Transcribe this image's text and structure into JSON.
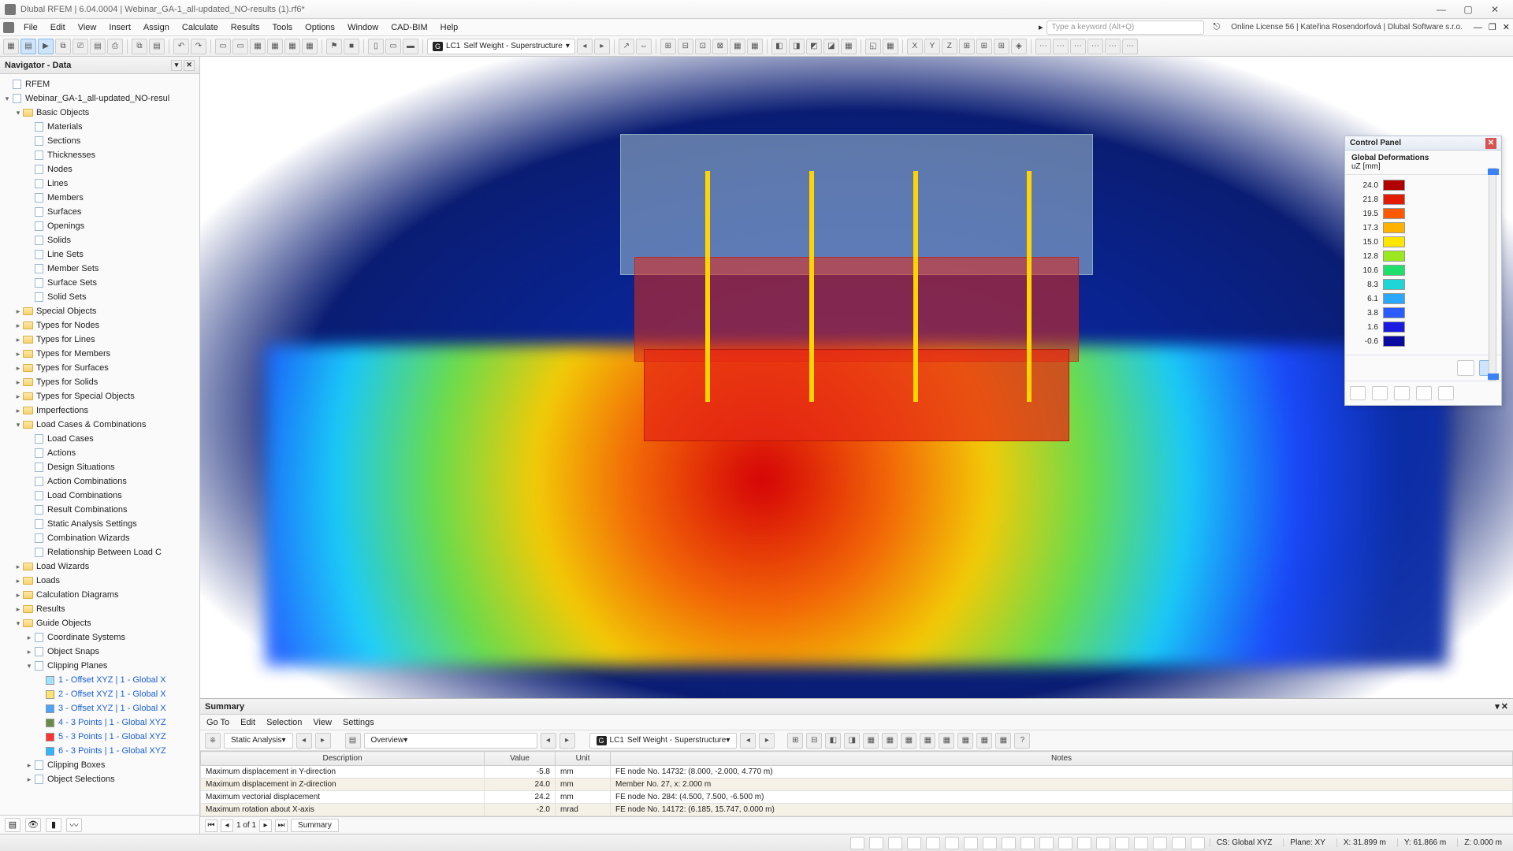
{
  "window": {
    "title": "Dlubal RFEM | 6.04.0004 | Webinar_GA-1_all-updated_NO-results (1).rf6*",
    "search_placeholder": "Type a keyword (Alt+Q)",
    "license": "Online License 56 | Kateřina Rosendorfová | Dlubal Software s.r.o."
  },
  "menu": [
    "File",
    "Edit",
    "View",
    "Insert",
    "Assign",
    "Calculate",
    "Results",
    "Tools",
    "Options",
    "Window",
    "CAD-BIM",
    "Help"
  ],
  "toolbar": {
    "lc_badge": "G",
    "lc_num": "LC1",
    "lc_name": "Self Weight - Superstructure"
  },
  "navigator": {
    "title": "Navigator - Data",
    "root": "RFEM",
    "model": "Webinar_GA-1_all-updated_NO-resul",
    "basic_objects_label": "Basic Objects",
    "basic_objects": [
      "Materials",
      "Sections",
      "Thicknesses",
      "Nodes",
      "Lines",
      "Members",
      "Surfaces",
      "Openings",
      "Solids",
      "Line Sets",
      "Member Sets",
      "Surface Sets",
      "Solid Sets"
    ],
    "groups": [
      "Special Objects",
      "Types for Nodes",
      "Types for Lines",
      "Types for Members",
      "Types for Surfaces",
      "Types for Solids",
      "Types for Special Objects",
      "Imperfections"
    ],
    "lcc_label": "Load Cases & Combinations",
    "lcc": [
      "Load Cases",
      "Actions",
      "Design Situations",
      "Action Combinations",
      "Load Combinations",
      "Result Combinations",
      "Static Analysis Settings",
      "Combination Wizards",
      "Relationship Between Load C"
    ],
    "post_groups": [
      "Load Wizards",
      "Loads",
      "Calculation Diagrams",
      "Results"
    ],
    "guide_label": "Guide Objects",
    "guide": [
      "Coordinate Systems",
      "Object Snaps"
    ],
    "clipping_label": "Clipping Planes",
    "clipping": [
      {
        "label": "1 - Offset XYZ | 1 - Global X",
        "color": "#9fe3ff"
      },
      {
        "label": "2 - Offset XYZ | 1 - Global X",
        "color": "#ffe46b"
      },
      {
        "label": "3 - Offset XYZ | 1 - Global X",
        "color": "#4aa3ff"
      },
      {
        "label": "4 - 3 Points | 1 - Global XYZ",
        "color": "#6a8a4a"
      },
      {
        "label": "5 - 3 Points | 1 - Global XYZ",
        "color": "#ff3030"
      },
      {
        "label": "6 - 3 Points | 1 - Global XYZ",
        "color": "#2fb6ff"
      }
    ],
    "after_clip": [
      "Clipping Boxes",
      "Object Selections"
    ]
  },
  "panel": {
    "title": "Control Panel",
    "subtitle": "Global Deformations",
    "unit": "uZ [mm]",
    "legend": [
      {
        "v": "24.0",
        "c": "#b10000"
      },
      {
        "v": "21.8",
        "c": "#e01b00"
      },
      {
        "v": "19.5",
        "c": "#ff5a00"
      },
      {
        "v": "17.3",
        "c": "#ffb300"
      },
      {
        "v": "15.0",
        "c": "#ffe600"
      },
      {
        "v": "12.8",
        "c": "#9be81f"
      },
      {
        "v": "10.6",
        "c": "#1fe06a"
      },
      {
        "v": "8.3",
        "c": "#1fd6d6"
      },
      {
        "v": "6.1",
        "c": "#2aa7ff"
      },
      {
        "v": "3.8",
        "c": "#2a5bff"
      },
      {
        "v": "1.6",
        "c": "#1a1ae0"
      },
      {
        "v": "-0.6",
        "c": "#0a0aa0"
      }
    ]
  },
  "summary": {
    "title": "Summary",
    "menu": [
      "Go To",
      "Edit",
      "Selection",
      "View",
      "Settings"
    ],
    "analysis_type": "Static Analysis",
    "overview": "Overview",
    "lc_badge": "G",
    "lc_num": "LC1",
    "lc_name": "Self Weight - Superstructure",
    "columns": [
      "Description",
      "Value",
      "Unit",
      "Notes"
    ],
    "rows": [
      {
        "d": "Maximum displacement in Y-direction",
        "v": "-5.8",
        "u": "mm",
        "n": "FE node No. 14732: (8.000, -2.000, 4.770 m)"
      },
      {
        "d": "Maximum displacement in Z-direction",
        "v": "24.0",
        "u": "mm",
        "n": "Member No. 27, x: 2.000 m"
      },
      {
        "d": "Maximum vectorial displacement",
        "v": "24.2",
        "u": "mm",
        "n": "FE node No. 284: (4.500, 7.500, -6.500 m)"
      },
      {
        "d": "Maximum rotation about X-axis",
        "v": "-2.0",
        "u": "mrad",
        "n": "FE node No. 14172: (6.185, 15.747, 0.000 m)"
      }
    ],
    "pager": "1 of 1",
    "tab": "Summary"
  },
  "status": {
    "cs": "CS: Global XYZ",
    "plane": "Plane: XY",
    "x": "X: 31.899 m",
    "y": "Y: 61.866 m",
    "z": "Z: 0.000 m"
  }
}
